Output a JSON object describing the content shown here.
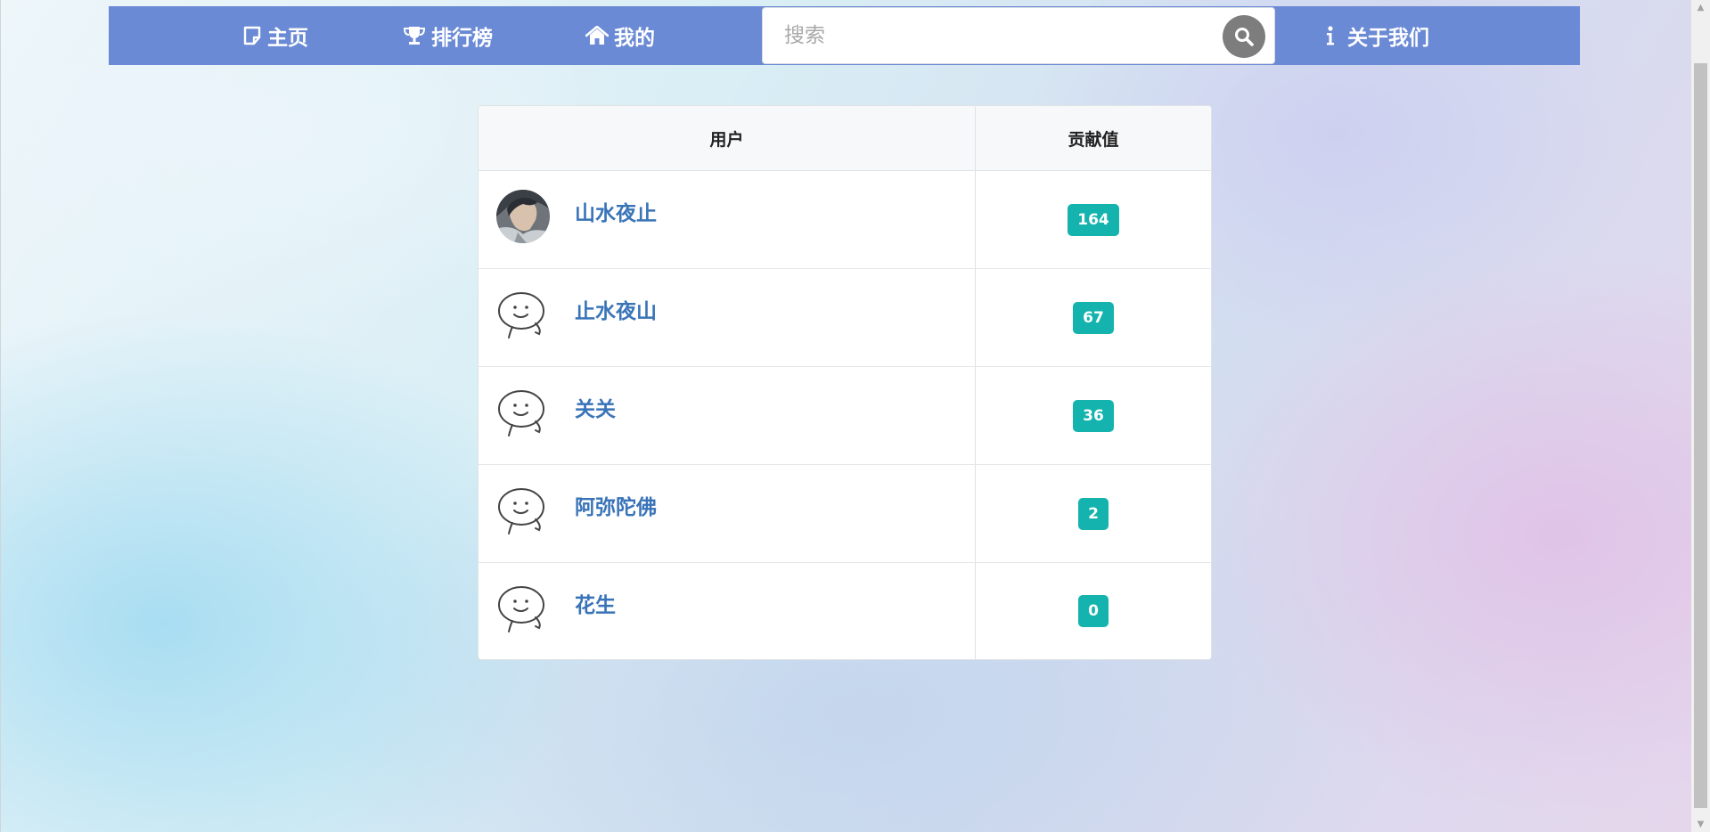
{
  "nav": {
    "home": "主页",
    "rank": "排行榜",
    "mine": "我的",
    "about": "关于我们",
    "search_placeholder": "搜索"
  },
  "table": {
    "headers": {
      "user": "用户",
      "score": "贡献值"
    },
    "rows": [
      {
        "name": "山水夜止",
        "score": "164",
        "avatar": "photo-avatar"
      },
      {
        "name": "止水夜山",
        "score": "67",
        "avatar": "default-smiley-avatar"
      },
      {
        "name": "关关",
        "score": "36",
        "avatar": "default-smiley-avatar"
      },
      {
        "name": "阿弥陀佛",
        "score": "2",
        "avatar": "default-smiley-avatar"
      },
      {
        "name": "花生",
        "score": "0",
        "avatar": "default-smiley-avatar"
      }
    ]
  },
  "colors": {
    "navbar": "#6b8ad5",
    "badge": "#14b3ad",
    "username": "#3a74b8"
  }
}
